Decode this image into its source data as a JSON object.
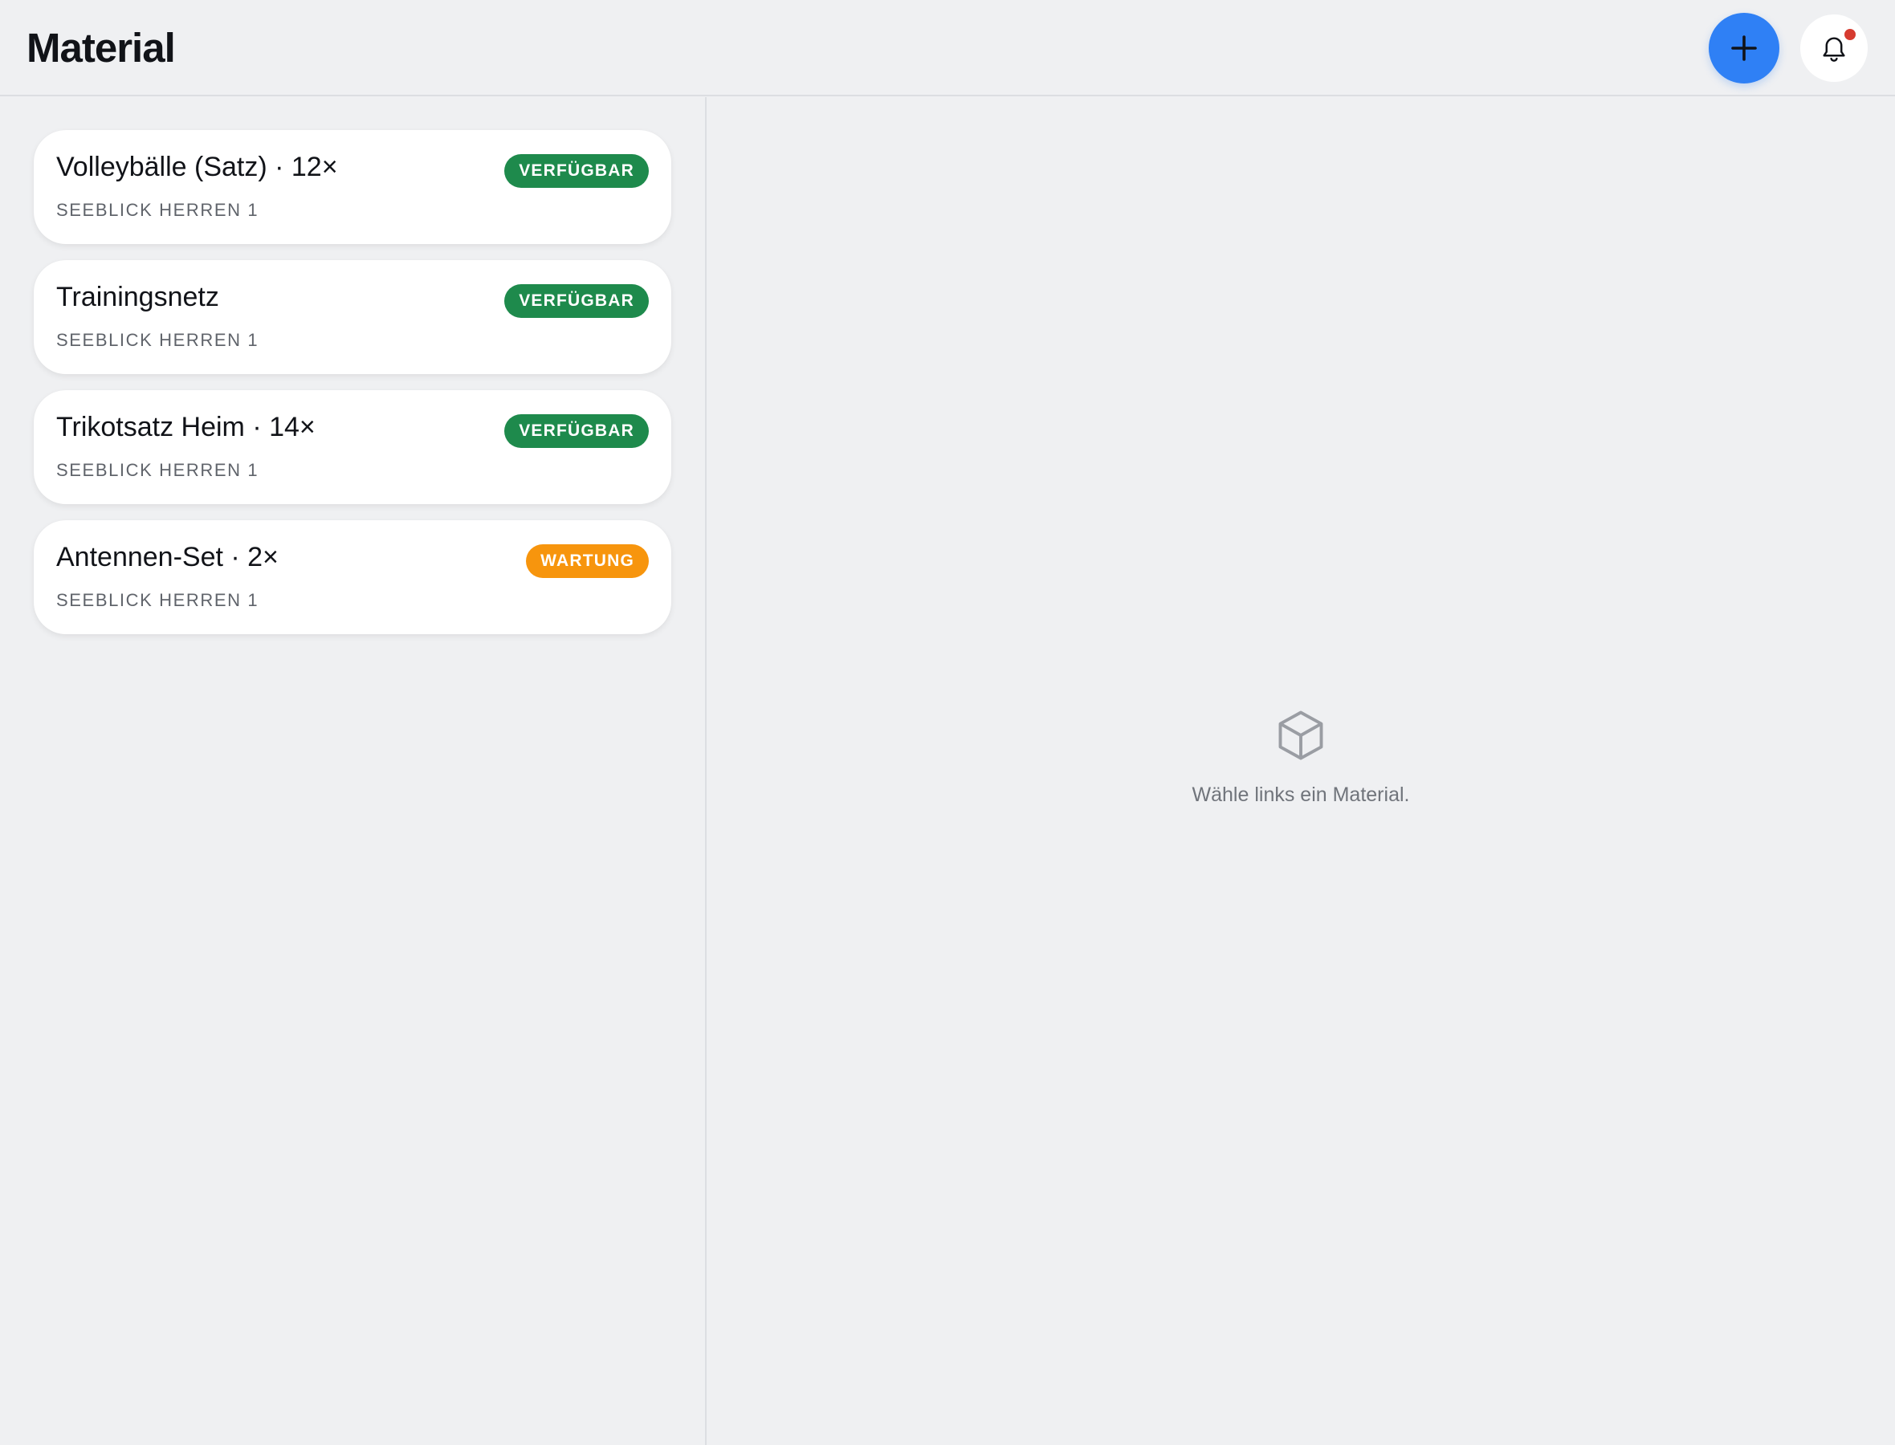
{
  "header": {
    "title": "Material",
    "add_icon": "plus-icon",
    "notification_icon": "bell-icon",
    "notification_dot": true
  },
  "colors": {
    "accent": "#2f80f5",
    "available": "#1e8a4c",
    "maintenance": "#f7950d",
    "notification_dot": "#d63b30"
  },
  "items": [
    {
      "title": "Volleybälle (Satz) · 12×",
      "team": "SEEBLICK HERREN 1",
      "status": "VERFÜGBAR",
      "status_type": "available"
    },
    {
      "title": "Trainingsnetz",
      "team": "SEEBLICK HERREN 1",
      "status": "VERFÜGBAR",
      "status_type": "available"
    },
    {
      "title": "Trikotsatz Heim · 14×",
      "team": "SEEBLICK HERREN 1",
      "status": "VERFÜGBAR",
      "status_type": "available"
    },
    {
      "title": "Antennen-Set · 2×",
      "team": "SEEBLICK HERREN 1",
      "status": "WARTUNG",
      "status_type": "maintenance"
    }
  ],
  "detail": {
    "empty_icon": "cube-icon",
    "empty_text": "Wähle links ein Material."
  }
}
